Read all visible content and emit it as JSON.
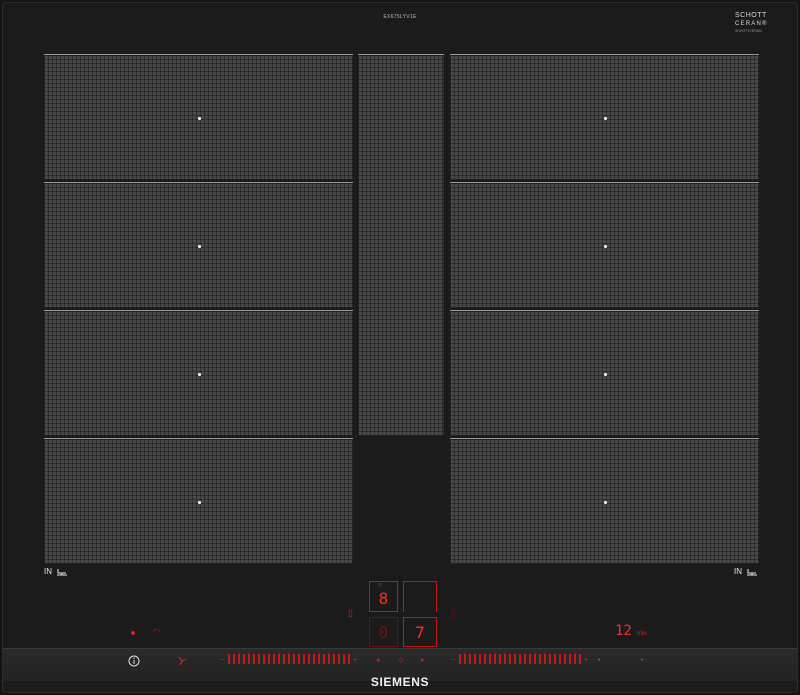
{
  "header": {
    "model": "EX675LYV1E",
    "logo": {
      "line1": "SCHOTT",
      "line2": "CERAN®",
      "line3": "SCHOTTCERAN"
    }
  },
  "zones": {
    "left": [
      "zone-l1",
      "zone-l2",
      "zone-l3",
      "zone-l4"
    ],
    "center": "zone-center",
    "right": [
      "zone-r1",
      "zone-r2",
      "zone-r3",
      "zone-r4"
    ]
  },
  "pan_indicators": {
    "left_label": "IN",
    "right_label": "IN"
  },
  "display": {
    "power_level": "8",
    "power_level_small": "8",
    "power_level_caption": "P",
    "second_digit": "7",
    "placeholder_digit": "0",
    "timer_value": "12",
    "timer_unit": "min"
  },
  "controls": {
    "info_icon": "info-circle-icon",
    "sensor_icon": "fan-sensor-icon",
    "left_minus": "−",
    "left_plus": "+",
    "right_minus": "−",
    "right_plus": "+"
  },
  "brand": "SIEMENS",
  "colors": {
    "glass": "#1b1b1b",
    "zone": "#474747",
    "led": "#e01e1e"
  }
}
